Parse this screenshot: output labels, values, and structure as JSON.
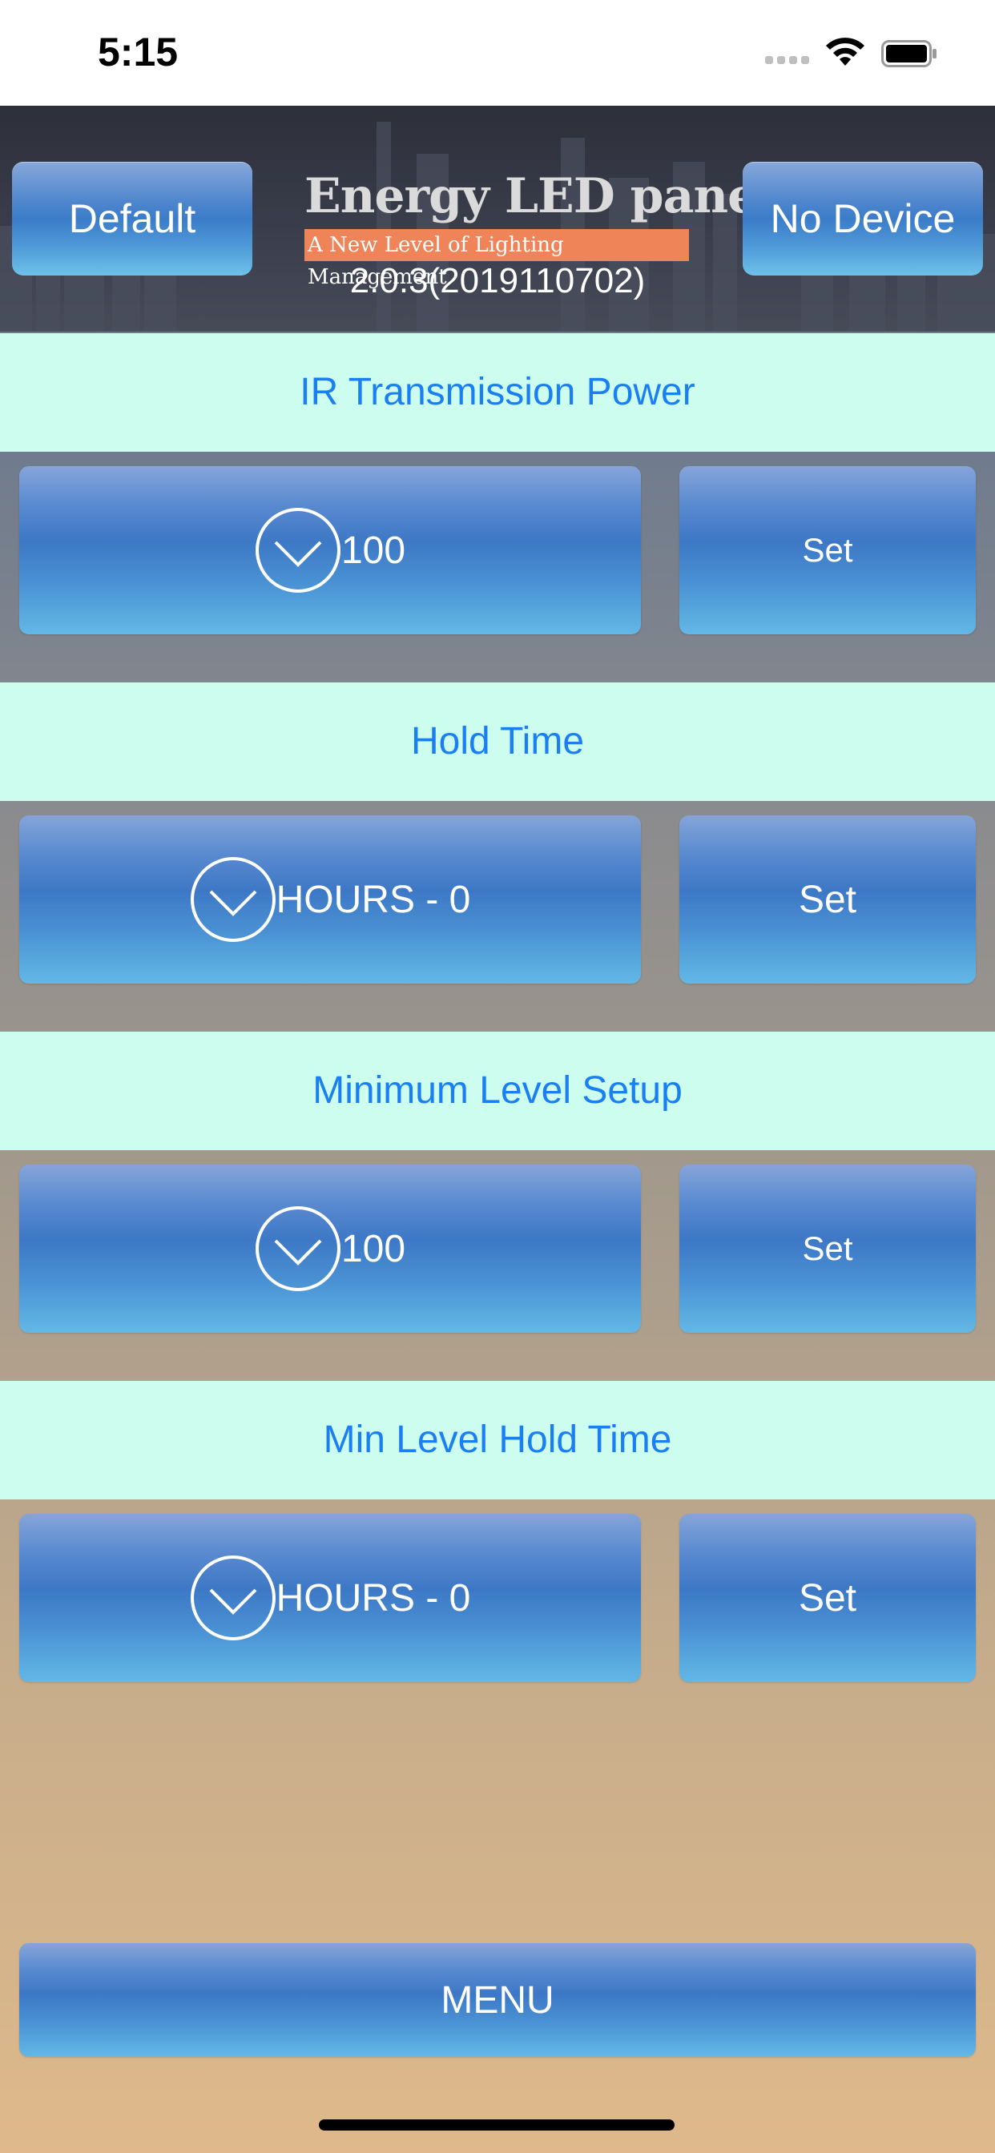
{
  "status_bar": {
    "time": "5:15"
  },
  "header": {
    "left_button": "Default",
    "right_button": "No Device",
    "logo_title": "Energy LED panel",
    "logo_subtitle": "A New Level of Lighting Management",
    "version": "2.0.3(2019110702)"
  },
  "sections": [
    {
      "title": "IR Transmission Power",
      "value": "100",
      "set_label": "Set"
    },
    {
      "title": "Hold Time",
      "value": "HOURS - 0",
      "set_label": "Set"
    },
    {
      "title": "Minimum Level Setup",
      "value": "100",
      "set_label": "Set"
    },
    {
      "title": "Min Level Hold Time",
      "value": "HOURS - 0",
      "set_label": "Set"
    }
  ],
  "menu_button": "MENU",
  "icons": {
    "dropdown": "chevron-down-icon",
    "wifi": "wifi-icon",
    "battery": "battery-icon",
    "signal": "signal-icon"
  }
}
